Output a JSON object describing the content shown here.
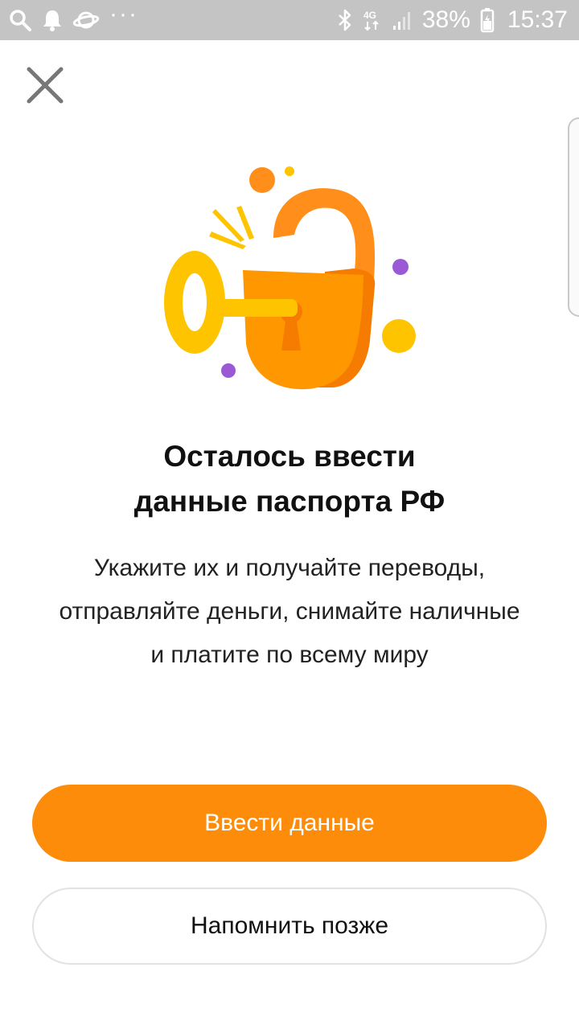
{
  "status_bar": {
    "left_icons": [
      "search-icon",
      "bell-icon",
      "planet-icon"
    ],
    "more_dots": "···",
    "network": "4G",
    "battery_percent": "38%",
    "time": "15:37"
  },
  "close": {
    "icon": "close-icon"
  },
  "illustration": {
    "name": "unlocked-padlock-with-key"
  },
  "title_line1": "Осталось ввести",
  "title_line2": "данные паспорта РФ",
  "subtitle_line1": "Укажите их и получайте переводы,",
  "subtitle_line2": "отправляйте деньги, снимайте наличные",
  "subtitle_line3": "и платите по всему миру",
  "primary_button": {
    "label": "Ввести данные"
  },
  "secondary_button": {
    "label": "Напомнить позже"
  },
  "colors": {
    "accent": "#fc8c0a",
    "status_bar": "#c4c4c4",
    "lock_orange": "#ff8f1a",
    "key_yellow": "#ffc400",
    "dot_purple": "#9b59d6"
  }
}
